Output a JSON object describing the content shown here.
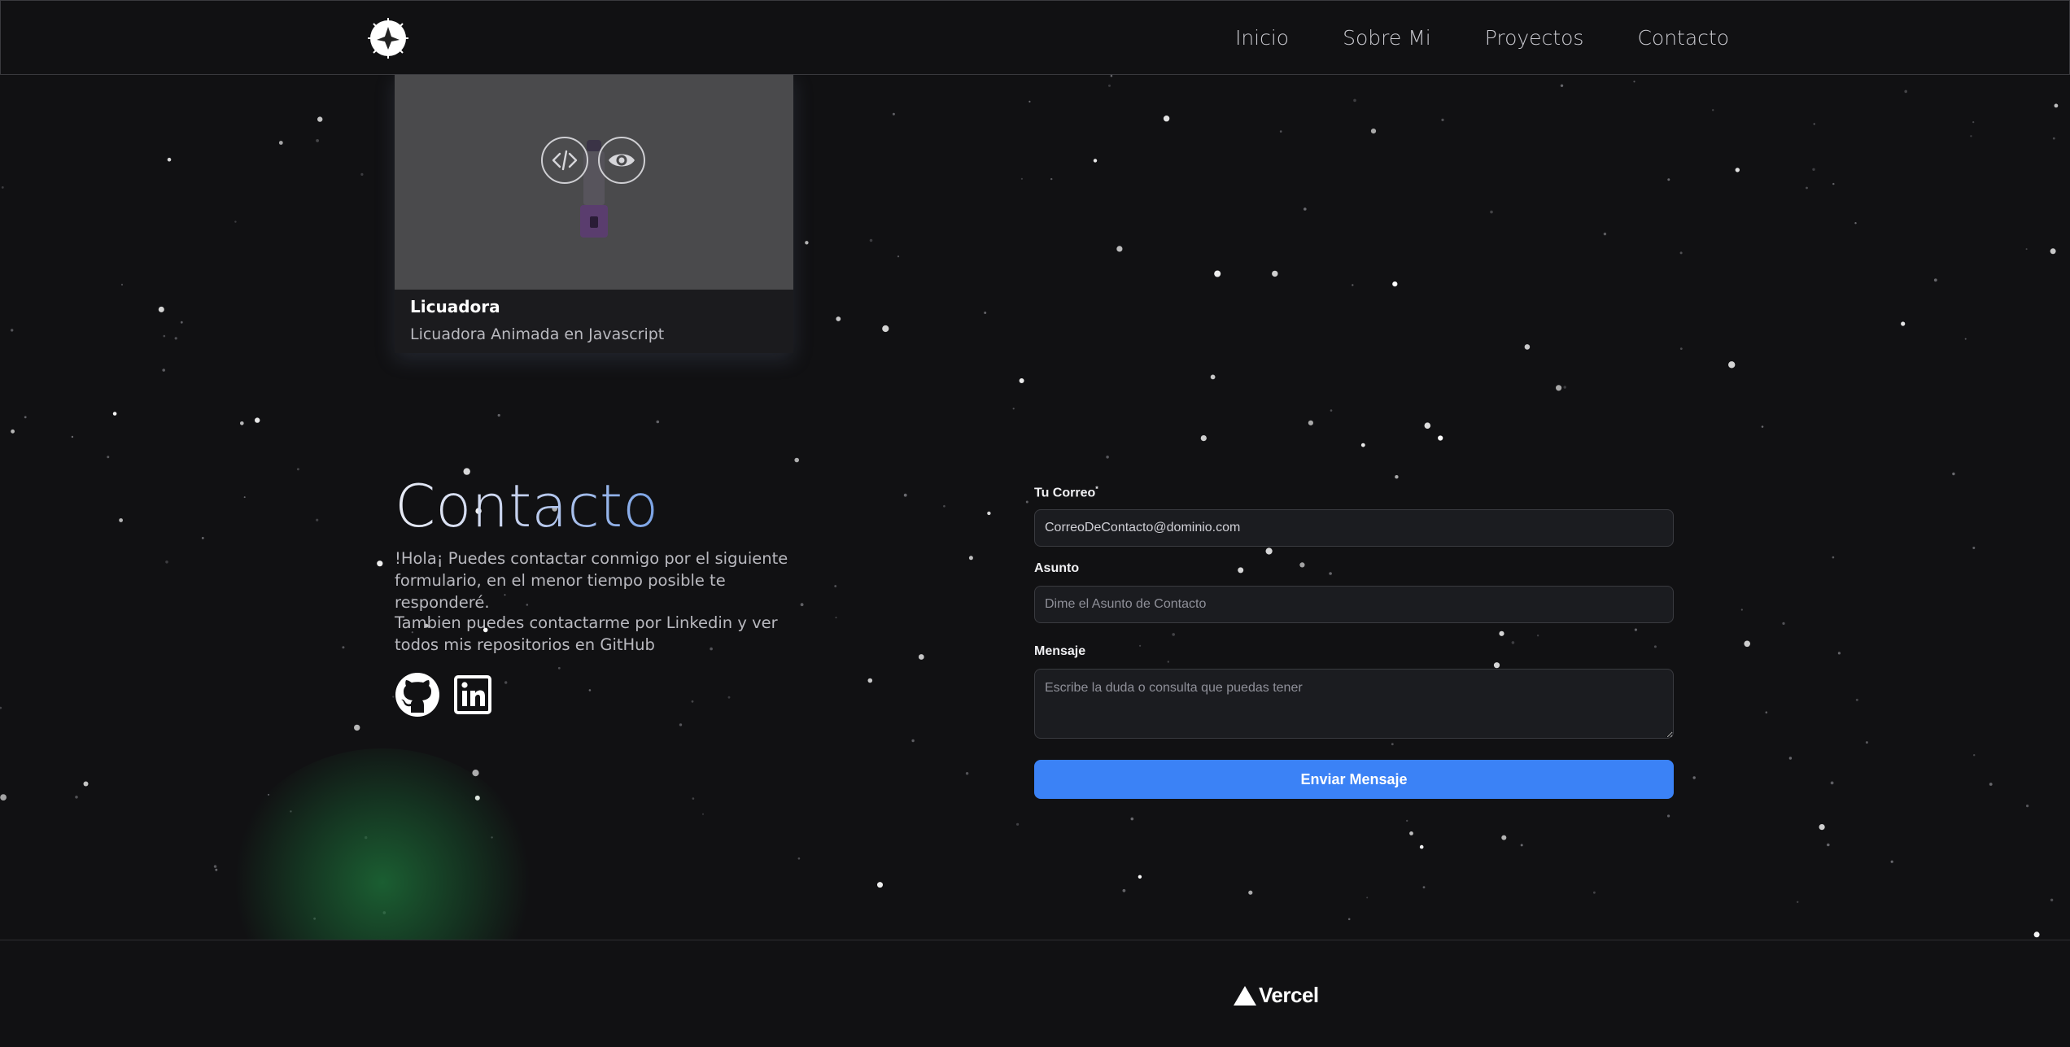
{
  "nav": {
    "logo": "site-logo",
    "items": [
      {
        "label": "Inicio"
      },
      {
        "label": "Sobre Mi"
      },
      {
        "label": "Proyectos"
      },
      {
        "label": "Contacto"
      }
    ]
  },
  "project_card": {
    "title": "Licuadora",
    "description": "Licuadora Animada en Javascript",
    "icons": [
      "code-icon",
      "eye-icon"
    ]
  },
  "contact": {
    "title": "Contacto",
    "paragraph1": "!Hola¡ Puedes contactar conmigo por el siguiente formulario, en el menor tiempo posible te responderé.",
    "paragraph2": "Tambien puedes contactarme por Linkedin y ver todos mis repositorios en GitHub",
    "social": [
      "github-icon",
      "linkedin-icon"
    ]
  },
  "form": {
    "email_label": "Tu Correo",
    "email_value": "CorreoDeContacto@dominio.com",
    "subject_label": "Asunto",
    "subject_placeholder": "Dime el Asunto de Contacto",
    "message_label": "Mensaje",
    "message_placeholder": "Escribe la duda o consulta que puedas tener",
    "submit_label": "Enviar Mensaje"
  },
  "footer": {
    "brand": "Vercel"
  },
  "colors": {
    "background": "#111113",
    "accent": "#3b82f6",
    "title_gradient_end": "#7aa3e6"
  }
}
